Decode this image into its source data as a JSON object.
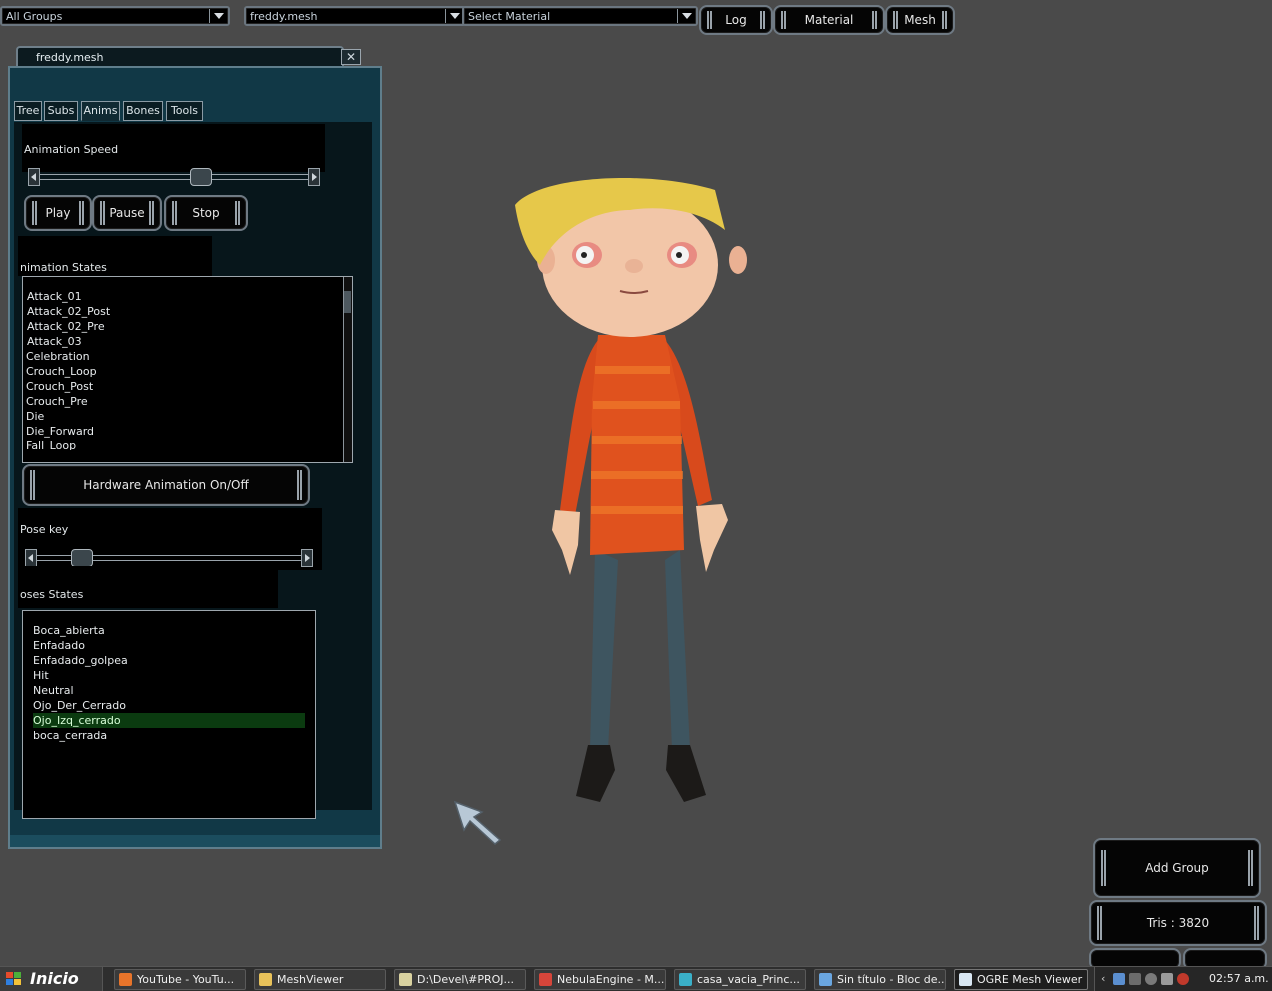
{
  "toolbar": {
    "group_combo": "All Groups",
    "mesh_combo": "freddy.mesh",
    "material_combo": "Select Material",
    "log_button": "Log",
    "material_button": "Material",
    "mesh_button": "Mesh"
  },
  "panel": {
    "title": "freddy.mesh",
    "tabs": [
      {
        "label": "Tree"
      },
      {
        "label": "Subs"
      },
      {
        "label": "Anims",
        "active": true
      },
      {
        "label": "Bones"
      },
      {
        "label": "Tools"
      }
    ],
    "animation_speed_label": "Animation Speed",
    "animation_speed_value": 0.55,
    "play_label": "Play",
    "pause_label": "Pause",
    "stop_label": "Stop",
    "animation_states_label": "nimation States",
    "animation_states": [
      "Attack_01",
      "Attack_02_Post",
      "Attack_02_Pre",
      "Attack_03",
      "Celebration",
      "Crouch_Loop",
      "Crouch_Post",
      "Crouch_Pre",
      "Die",
      "Die_Forward",
      "Fall_Loop"
    ],
    "hardware_anim_label": "Hardware Animation On/Off",
    "pose_key_label": "Pose key",
    "pose_key_value": 0.18,
    "poses_states_label": "oses States",
    "pose_states": [
      "Boca_abierta",
      "Enfadado",
      "Enfadado_golpea",
      "Hit",
      "Neutral",
      "Ojo_Der_Cerrado",
      "Ojo_Izq_cerrado",
      "boca_cerrada"
    ],
    "selected_pose": "Ojo_Izq_cerrado"
  },
  "corner": {
    "add_group": "Add Group",
    "tris": "Tris : 3820"
  },
  "taskbar": {
    "start": "Inicio",
    "items": [
      {
        "label": "YouTube - YouTu...",
        "color": "#e8742a"
      },
      {
        "label": "MeshViewer",
        "color": "#e8c25a"
      },
      {
        "label": "D:\\Devel\\#PROJ...",
        "color": "#d9d2a0"
      },
      {
        "label": "NebulaEngine - M...",
        "color": "#d6453a"
      },
      {
        "label": "casa_vacia_Princ...",
        "color": "#3ab0c8"
      },
      {
        "label": "Sin título - Bloc de...",
        "color": "#6aa6e0"
      },
      {
        "label": "OGRE Mesh Viewer",
        "color": "#d8e6f2",
        "active": true
      }
    ],
    "clock": "02:57 a.m."
  }
}
